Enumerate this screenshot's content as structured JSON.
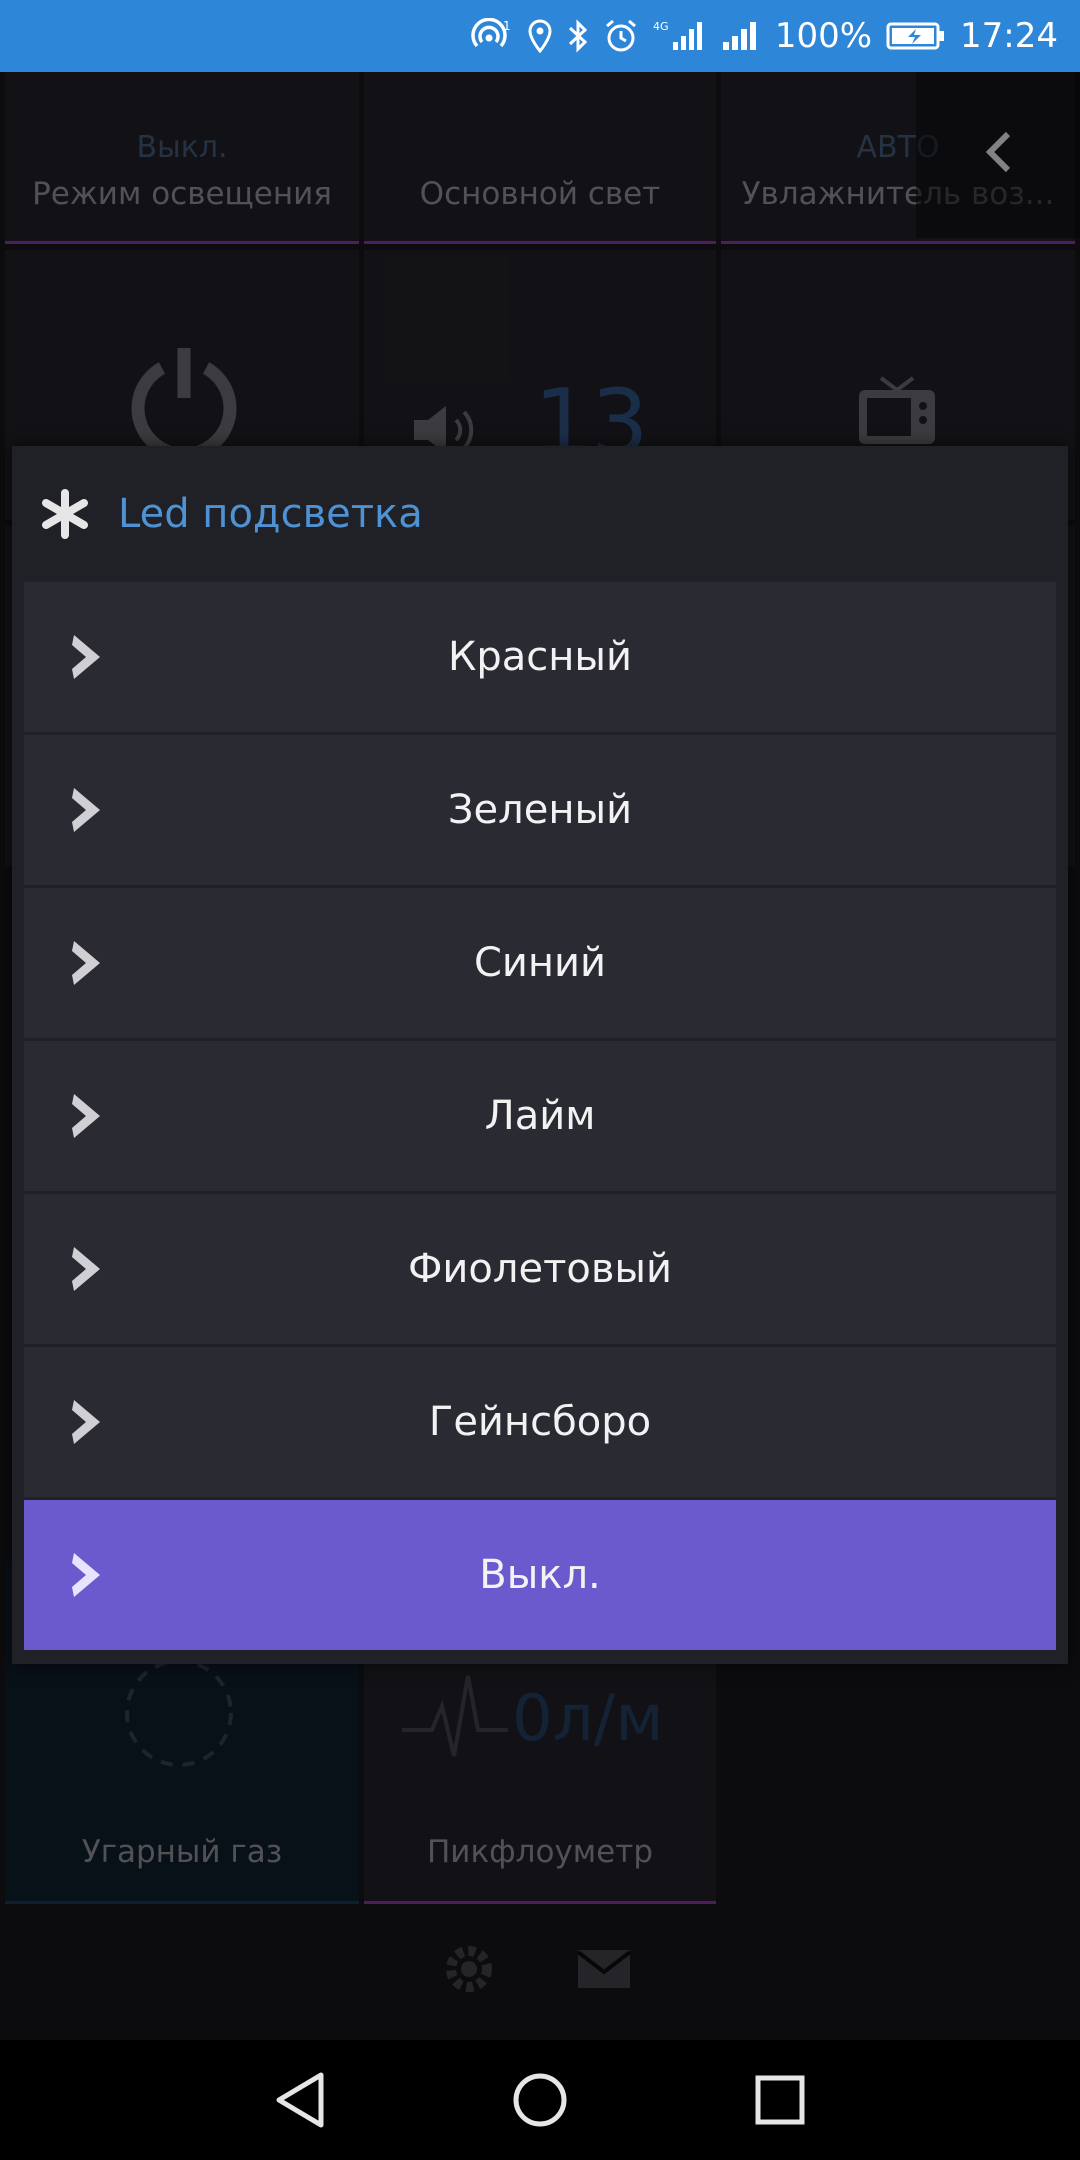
{
  "status_bar": {
    "battery_percent": "100%",
    "time": "17:24",
    "network_type": "4G",
    "icons": [
      "hotspot-icon",
      "location-icon",
      "bluetooth-icon",
      "alarm-icon",
      "signal-4g-icon",
      "signal-icon",
      "battery-charging-icon"
    ]
  },
  "dashboard": {
    "tiles": [
      {
        "state": "Выкл.",
        "label": "Режим освещения",
        "icon": "light-mode-icon"
      },
      {
        "state": "",
        "label": "Основной свет",
        "icon": "bulb-icon"
      },
      {
        "state": "АВТО",
        "label": "Увлажнитель воз...",
        "icon": "humidifier-icon"
      },
      {
        "label": "",
        "icon": "power-icon"
      },
      {
        "value": "13",
        "icon": "volume-icon"
      },
      {
        "label": "",
        "icon": "tv-icon"
      },
      {
        "label": "Угарный газ",
        "icon": "co-sensor-icon"
      },
      {
        "value": "0л/м",
        "label": "Пикфлоуметр",
        "icon": "heartbeat-icon"
      }
    ],
    "back_icon": "chevron-left-icon",
    "footer_icons": [
      "gear-icon",
      "mail-icon"
    ]
  },
  "dialog": {
    "icon": "asterisk-icon",
    "title": "Led подсветка",
    "options": [
      {
        "label": "Красный",
        "selected": false
      },
      {
        "label": "Зеленый",
        "selected": false
      },
      {
        "label": "Синий",
        "selected": false
      },
      {
        "label": "Лайм",
        "selected": false
      },
      {
        "label": "Фиолетовый",
        "selected": false
      },
      {
        "label": "Гейнсборо",
        "selected": false
      },
      {
        "label": "Выкл.",
        "selected": true
      }
    ],
    "selected_color": "#6a5acd",
    "title_color": "#4f92d4"
  },
  "nav_bar": {
    "buttons": [
      "back-triangle-icon",
      "home-circle-icon",
      "recents-square-icon"
    ]
  }
}
